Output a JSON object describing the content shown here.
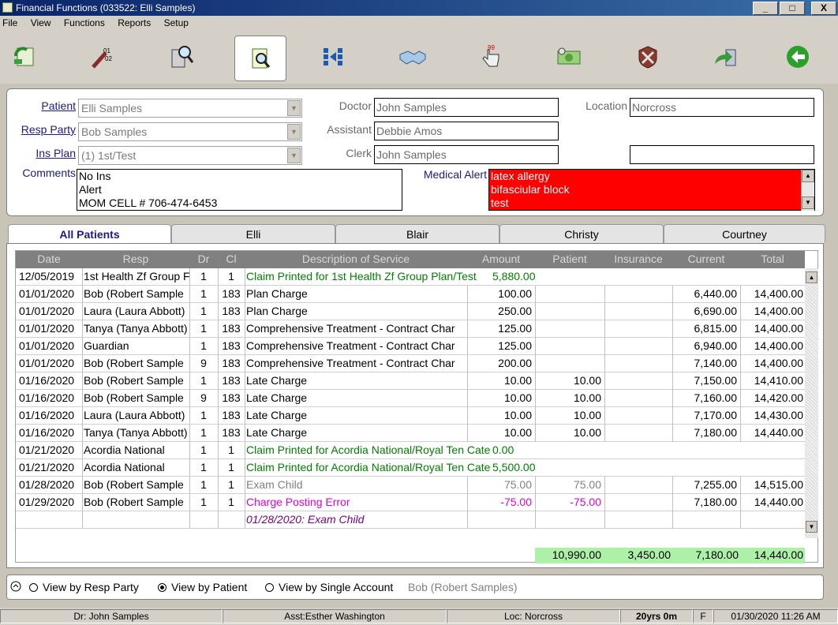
{
  "window": {
    "title": "Financial Functions (033522: Elli Samples)",
    "minimize": "_",
    "maximize": "□",
    "close": "X"
  },
  "menu": [
    "File",
    "View",
    "Functions",
    "Reports",
    "Setup"
  ],
  "toolbar": [
    {
      "icon": "refresh-ledger-icon"
    },
    {
      "icon": "code-wand-icon"
    },
    {
      "icon": "calculator-search-icon"
    },
    {
      "icon": "document-search-icon",
      "active": true
    },
    {
      "icon": "split-arrows-icon"
    },
    {
      "icon": "handshake-icon"
    },
    {
      "icon": "hand-pointer-icon"
    },
    {
      "icon": "money-icon"
    },
    {
      "icon": "shield-cross-icon"
    },
    {
      "icon": "export-arrow-icon"
    },
    {
      "icon": "back-arrow-icon"
    }
  ],
  "patient": {
    "patient_label": "Patient",
    "patient_value": "Elli Samples",
    "resp_label": "Resp Party",
    "resp_value": "Bob Samples",
    "ins_label": "Ins Plan",
    "ins_value": "(1) 1st/Test",
    "comments_label": "Comments",
    "comments": [
      "No Ins",
      "Alert",
      "MOM CELL # 706-474-6453"
    ],
    "doctor_label": "Doctor",
    "doctor_value": "John Samples",
    "assistant_label": "Assistant",
    "assistant_value": "Debbie Amos",
    "clerk_label": "Clerk",
    "clerk_value": "John Samples",
    "location_label": "Location",
    "location_value": "Norcross",
    "extra_value": "",
    "alert_label": "Medical Alert",
    "alerts": [
      "latex allergy",
      "bifasciular block",
      " test"
    ]
  },
  "tabs": [
    "All Patients",
    "Elli",
    "Blair",
    "Christy",
    "Courtney"
  ],
  "columns": [
    "Date",
    "Resp",
    "Dr",
    "Cl",
    "Description of Service",
    "Amount",
    "Patient",
    "Insurance",
    "Current",
    "Total"
  ],
  "rows": [
    {
      "date": "12/05/2019",
      "resp": "1st Health Zf Group F",
      "dr": "1",
      "cl": "1",
      "desc": "Claim Printed for 1st Health Zf Group Plan/Test",
      "amount": "5,880.00",
      "patient": "",
      "insurance": "",
      "current": "",
      "total": "",
      "style": "green",
      "claim": true
    },
    {
      "date": "01/01/2020",
      "resp": "Bob (Robert Sample",
      "dr": "1",
      "cl": "183",
      "desc": "Plan Charge",
      "amount": "100.00",
      "patient": "",
      "insurance": "",
      "current": "6,440.00",
      "total": "14,400.00",
      "style": ""
    },
    {
      "date": "01/01/2020",
      "resp": "Laura (Laura Abbott)",
      "dr": "1",
      "cl": "183",
      "desc": "Plan Charge",
      "amount": "250.00",
      "patient": "",
      "insurance": "",
      "current": "6,690.00",
      "total": "14,400.00",
      "style": ""
    },
    {
      "date": "01/01/2020",
      "resp": "Tanya (Tanya Abbott)",
      "dr": "1",
      "cl": "183",
      "desc": "Comprehensive Treatment - Contract Char",
      "amount": "125.00",
      "patient": "",
      "insurance": "",
      "current": "6,815.00",
      "total": "14,400.00",
      "style": ""
    },
    {
      "date": "01/01/2020",
      "resp": "Guardian",
      "dr": "1",
      "cl": "183",
      "desc": "Comprehensive Treatment - Contract Char",
      "amount": "125.00",
      "patient": "",
      "insurance": "",
      "current": "6,940.00",
      "total": "14,400.00",
      "style": ""
    },
    {
      "date": "01/01/2020",
      "resp": "Bob (Robert Sample",
      "dr": "9",
      "cl": "183",
      "desc": "Comprehensive Treatment - Contract Char",
      "amount": "200.00",
      "patient": "",
      "insurance": "",
      "current": "7,140.00",
      "total": "14,400.00",
      "style": ""
    },
    {
      "date": "01/16/2020",
      "resp": "Bob (Robert Sample",
      "dr": "1",
      "cl": "183",
      "desc": "Late Charge",
      "amount": "10.00",
      "patient": "10.00",
      "insurance": "",
      "current": "7,150.00",
      "total": "14,410.00",
      "style": ""
    },
    {
      "date": "01/16/2020",
      "resp": "Bob (Robert Sample",
      "dr": "9",
      "cl": "183",
      "desc": "Late Charge",
      "amount": "10.00",
      "patient": "10.00",
      "insurance": "",
      "current": "7,160.00",
      "total": "14,420.00",
      "style": ""
    },
    {
      "date": "01/16/2020",
      "resp": "Laura (Laura Abbott)",
      "dr": "1",
      "cl": "183",
      "desc": "Late Charge",
      "amount": "10.00",
      "patient": "10.00",
      "insurance": "",
      "current": "7,170.00",
      "total": "14,430.00",
      "style": ""
    },
    {
      "date": "01/16/2020",
      "resp": "Tanya (Tanya Abbott)",
      "dr": "1",
      "cl": "183",
      "desc": "Late Charge",
      "amount": "10.00",
      "patient": "10.00",
      "insurance": "",
      "current": "7,180.00",
      "total": "14,440.00",
      "style": ""
    },
    {
      "date": "01/21/2020",
      "resp": "Acordia National",
      "dr": "1",
      "cl": "1",
      "desc": "Claim Printed for Acordia National/Royal Ten Cate",
      "amount": "0.00",
      "patient": "",
      "insurance": "",
      "current": "",
      "total": "",
      "style": "green",
      "claim": true
    },
    {
      "date": "01/21/2020",
      "resp": "Acordia National",
      "dr": "1",
      "cl": "1",
      "desc": "Claim Printed for Acordia National/Royal Ten Cate",
      "amount": "5,500.00",
      "patient": "",
      "insurance": "",
      "current": "",
      "total": "",
      "style": "green",
      "claim": true
    },
    {
      "date": "01/28/2020",
      "resp": "Bob (Robert Sample",
      "dr": "1",
      "cl": "1",
      "desc": "Exam Child",
      "amount": "75.00",
      "patient": "75.00",
      "insurance": "",
      "current": "7,255.00",
      "total": "14,515.00",
      "style": "gray"
    },
    {
      "date": "01/29/2020",
      "resp": "Bob (Robert Sample",
      "dr": "1",
      "cl": "1",
      "desc": "Charge Posting Error",
      "amount": "-75.00",
      "patient": "-75.00",
      "insurance": "",
      "current": "7,180.00",
      "total": "14,440.00",
      "style": "magenta"
    },
    {
      "date": "",
      "resp": "",
      "dr": "",
      "cl": "",
      "desc": "01/28/2020: Exam Child",
      "amount": "",
      "patient": "",
      "insurance": "",
      "current": "",
      "total": "",
      "style": "purple",
      "note": true
    }
  ],
  "totals": {
    "patient": "10,990.00",
    "insurance": "3,450.00",
    "current": "7,180.00",
    "total": "14,440.00"
  },
  "view": {
    "options": [
      "View by Resp Party",
      "View by Patient",
      "View by Single Account"
    ],
    "selected": 1,
    "account": "Bob (Robert Samples)"
  },
  "status": {
    "doctor": "Dr: John Samples",
    "assistant": "Asst:Esther Washington",
    "location": "Loc: Norcross",
    "age": "20yrs 0m",
    "sex": "F",
    "datetime": "01/30/2020 11:26 AM"
  }
}
